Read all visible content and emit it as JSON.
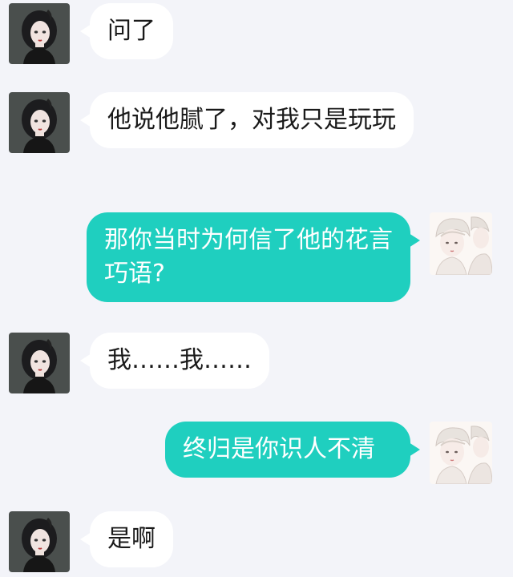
{
  "colors": {
    "background": "#f3f4f9",
    "incoming_bubble": "#ffffff",
    "outgoing_bubble": "#1fcfbf",
    "incoming_text": "#1a1a1a",
    "outgoing_text": "#ffffff"
  },
  "messages": [
    {
      "side": "in",
      "avatar": "girl-avatar",
      "text": "问了"
    },
    {
      "side": "in",
      "avatar": "girl-avatar",
      "text": "他说他腻了，对我只是玩玩"
    },
    {
      "side": "out",
      "avatar": "boy-avatar",
      "text": "那你当时为何信了他的花言巧语?"
    },
    {
      "side": "in",
      "avatar": "girl-avatar",
      "text": "我……我……"
    },
    {
      "side": "out",
      "avatar": "boy-avatar",
      "text": "终归是你识人不清"
    },
    {
      "side": "in",
      "avatar": "girl-avatar",
      "text": "是啊"
    }
  ]
}
